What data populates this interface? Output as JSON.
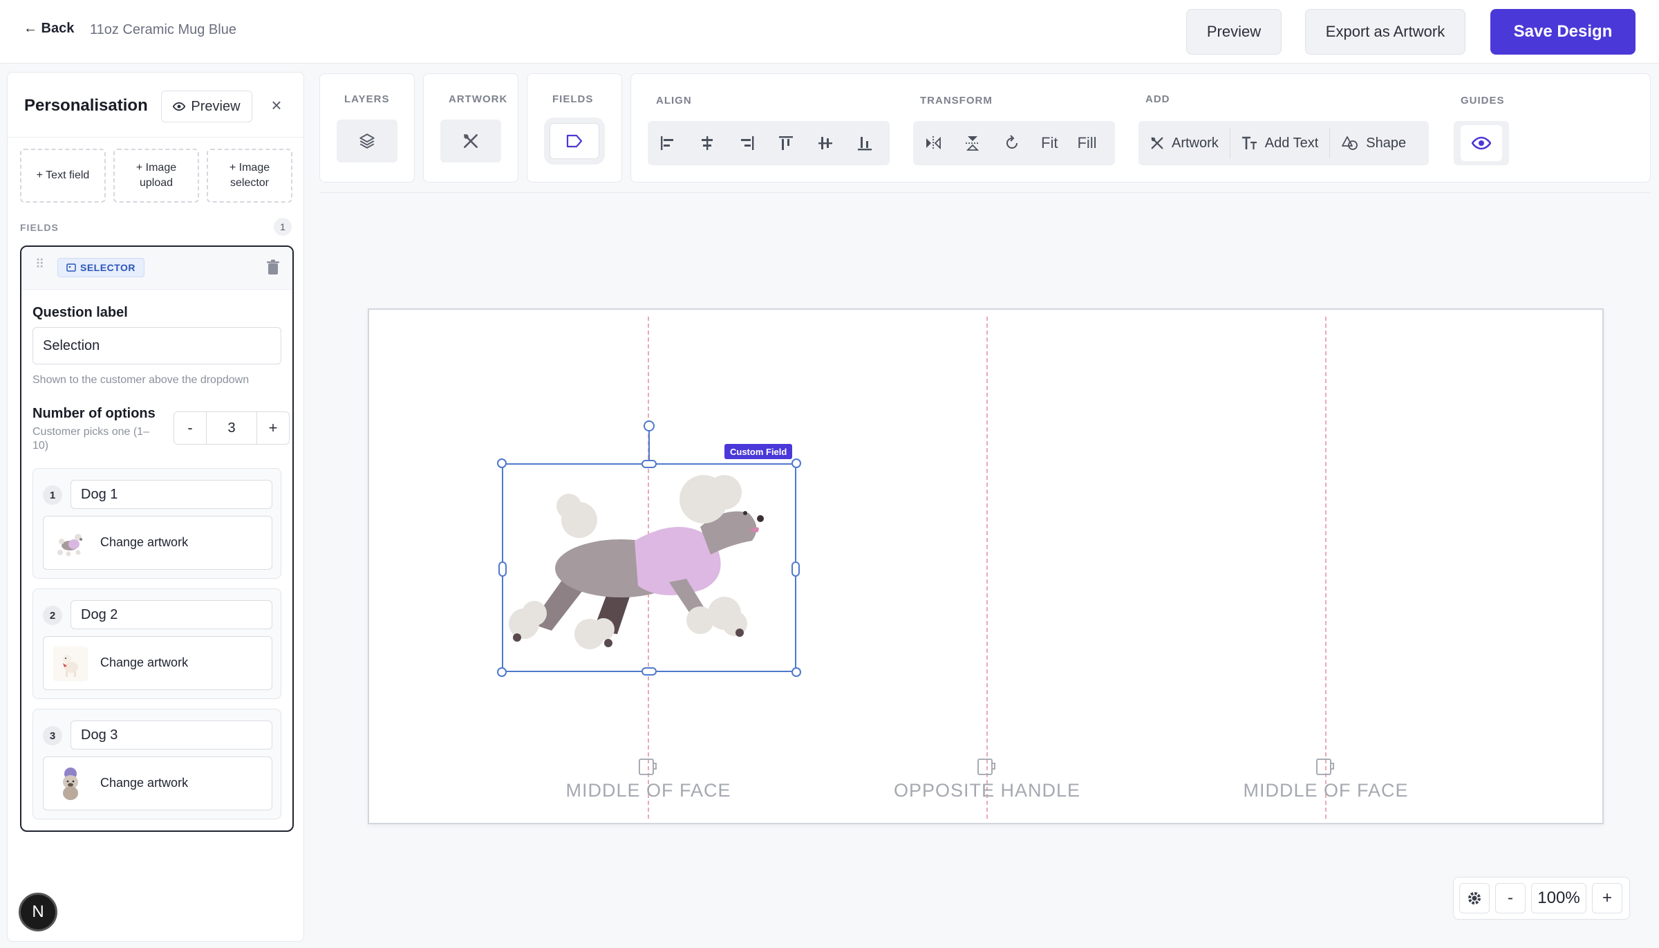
{
  "header": {
    "back_label": "← Back",
    "doc_title": "11oz Ceramic Mug Blue",
    "preview_label": "Preview",
    "export_label": "Export as Artwork",
    "save_label": "Save Design"
  },
  "sidebar": {
    "title": "Personalisation",
    "preview_label": "Preview",
    "add_buttons": [
      "+ Text field",
      "+ Image upload",
      "+ Image selector"
    ],
    "fields_label": "FIELDS",
    "fields_count": "1",
    "field": {
      "badge": "SELECTOR",
      "question_label": "Question label",
      "question_value": "Selection",
      "question_help": "Shown to the customer above the dropdown",
      "options_label": "Number of options",
      "options_help": "Customer picks one (1–10)",
      "options_count": "3",
      "options": [
        {
          "num": "1",
          "name": "Dog 1",
          "art_label": "Change artwork"
        },
        {
          "num": "2",
          "name": "Dog 2",
          "art_label": "Change artwork"
        },
        {
          "num": "3",
          "name": "Dog 3",
          "art_label": "Change artwork"
        }
      ]
    },
    "avatar_letter": "N"
  },
  "toolbar": {
    "layers_title": "LAYERS",
    "artwork_title": "ARTWORK",
    "fields_title": "FIELDS",
    "align_title": "ALIGN",
    "transform_title": "TRANSFORM",
    "fit_label": "Fit",
    "fill_label": "Fill",
    "add_title": "ADD",
    "add_artwork": "Artwork",
    "add_text": "Add Text",
    "add_shape": "Shape",
    "guides_title": "GUIDES"
  },
  "canvas": {
    "custom_field_tag": "Custom Field",
    "zones": [
      "MIDDLE OF FACE",
      "OPPOSITE HANDLE",
      "MIDDLE OF FACE"
    ]
  },
  "zoom": {
    "value": "100%",
    "minus": "-",
    "plus": "+"
  },
  "colors": {
    "accent": "#4b38d8",
    "selection": "#4e78cc",
    "guide": "#e9a9b8"
  }
}
